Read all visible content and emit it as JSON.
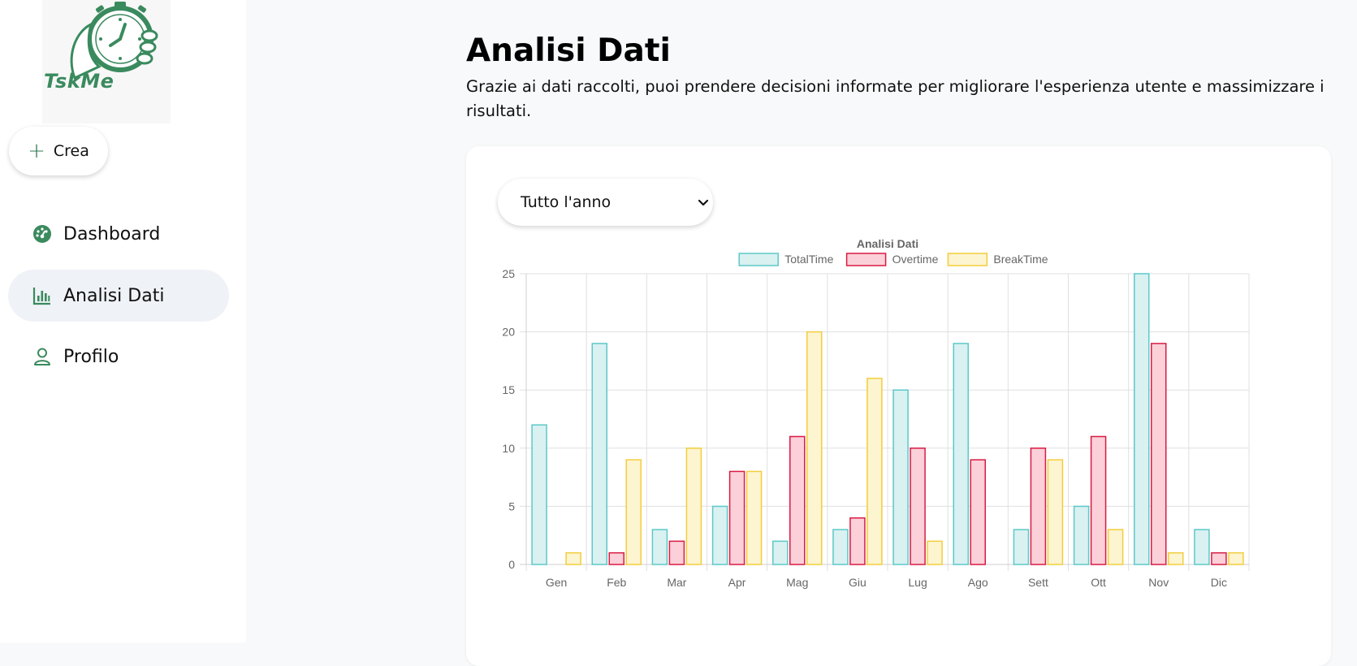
{
  "app": {
    "logo_text": "TskMe"
  },
  "sidebar": {
    "create_label": "Crea",
    "items": [
      {
        "label": "Dashboard",
        "icon": "gauge-icon"
      },
      {
        "label": "Analisi Dati",
        "icon": "bar-chart-icon",
        "active": true
      },
      {
        "label": "Profilo",
        "icon": "user-icon"
      }
    ]
  },
  "main": {
    "title": "Analisi Dati",
    "subtitle": "Grazie ai dati raccolti, puoi prendere decisioni informate per migliorare l'esperienza utente e massimizzare i risultati.",
    "period": {
      "selected": "Tutto l'anno"
    }
  },
  "colors": {
    "accent": "#3a8a5e",
    "total_border": "#5ec8c8",
    "total_fill": "#d9f1f1",
    "overtime_border": "#d81b43",
    "overtime_fill": "#fbd0d9",
    "break_border": "#f2ce3c",
    "break_fill": "#fdf4d0"
  },
  "chart_data": {
    "type": "bar",
    "title": "Analisi Dati",
    "categories": [
      "Gen",
      "Feb",
      "Mar",
      "Apr",
      "Mag",
      "Giu",
      "Lug",
      "Ago",
      "Sett",
      "Ott",
      "Nov",
      "Dic"
    ],
    "series": [
      {
        "name": "TotalTime",
        "values": [
          12,
          19,
          3,
          5,
          2,
          3,
          15,
          19,
          3,
          5,
          25,
          3
        ]
      },
      {
        "name": "Overtime",
        "values": [
          0,
          1,
          2,
          8,
          11,
          4,
          10,
          9,
          10,
          11,
          19,
          1
        ]
      },
      {
        "name": "BreakTime",
        "values": [
          1,
          9,
          10,
          8,
          20,
          16,
          2,
          0,
          9,
          3,
          1,
          1
        ]
      }
    ],
    "ylim": [
      0,
      25
    ],
    "yticks": [
      0,
      5,
      10,
      15,
      20,
      25
    ],
    "legend": "top",
    "grid": true
  }
}
